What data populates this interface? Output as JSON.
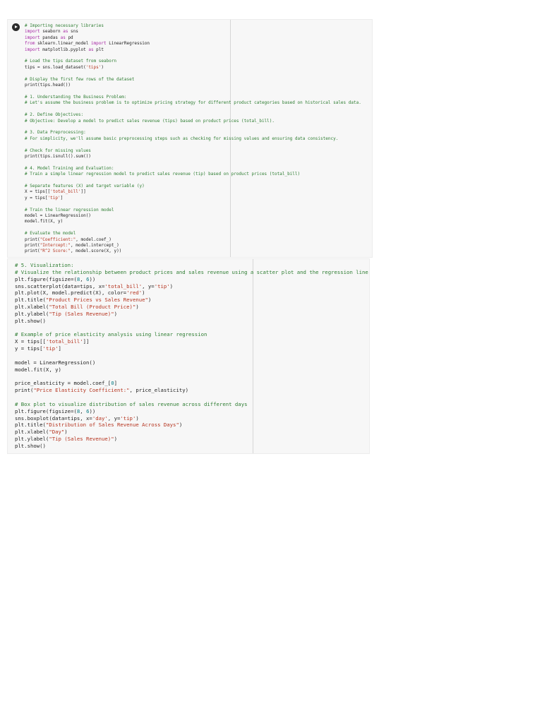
{
  "cells": [
    {
      "id": "cell1",
      "run_button": "play-icon",
      "lines": [
        "# Importing necessary libraries",
        "import seaborn as sns",
        "import pandas as pd",
        "from sklearn.linear_model import LinearRegression",
        "import matplotlib.pyplot as plt",
        "",
        "# Load the tips dataset from seaborn",
        "tips = sns.load_dataset('tips')",
        "",
        "# Display the first few rows of the dataset",
        "print(tips.head())",
        "",
        "# 1. Understanding the Business Problem:",
        "# Let's assume the business problem is to optimize pricing strategy for different product categories based on historical sales data.",
        "",
        "# 2. Define Objectives:",
        "# Objective: Develop a model to predict sales revenue (tips) based on product prices (total_bill).",
        "",
        "# 3. Data Preprocessing:",
        "# For simplicity, we'll assume basic preprocessing steps such as checking for missing values and ensuring data consistency.",
        "",
        "# Check for missing values",
        "print(tips.isnull().sum())",
        "",
        "# 4. Model Training and Evaluation:",
        "# Train a simple linear regression model to predict sales revenue (tip) based on product prices (total_bill)",
        "",
        "# Separate features (X) and target variable (y)",
        "X = tips[['total_bill']]",
        "y = tips['tip']",
        "",
        "# Train the linear regression model",
        "model = LinearRegression()",
        "model.fit(X, y)",
        "",
        "# Evaluate the model",
        "print(\"Coefficient:\", model.coef_)",
        "print(\"Intercept:\", model.intercept_)",
        "print(\"R^2 Score:\", model.score(X, y))"
      ]
    },
    {
      "id": "cell2",
      "lines": [
        "# 5. Visualization:",
        "# Visualize the relationship between product prices and sales revenue using a scatter plot and the regression line",
        "plt.figure(figsize=(8, 6))",
        "sns.scatterplot(data=tips, x='total_bill', y='tip')",
        "plt.plot(X, model.predict(X), color='red')",
        "plt.title(\"Product Prices vs Sales Revenue\")",
        "plt.xlabel(\"Total Bill (Product Price)\")",
        "plt.ylabel(\"Tip (Sales Revenue)\")",
        "plt.show()",
        "",
        "# Example of price elasticity analysis using linear regression",
        "X = tips[['total_bill']]",
        "y = tips['tip']",
        "",
        "model = LinearRegression()",
        "model.fit(X, y)",
        "",
        "price_elasticity = model.coef_[0]",
        "print(\"Price Elasticity Coefficient:\", price_elasticity)",
        "",
        "# Box plot to visualize distribution of sales revenue across different days",
        "plt.figure(figsize=(8, 6))",
        "sns.boxplot(data=tips, x='day', y='tip')",
        "plt.title(\"Distribution of Sales Revenue Across Days\")",
        "plt.xlabel(\"Day\")",
        "plt.ylabel(\"Tip (Sales Revenue)\")",
        "plt.show()"
      ]
    }
  ]
}
